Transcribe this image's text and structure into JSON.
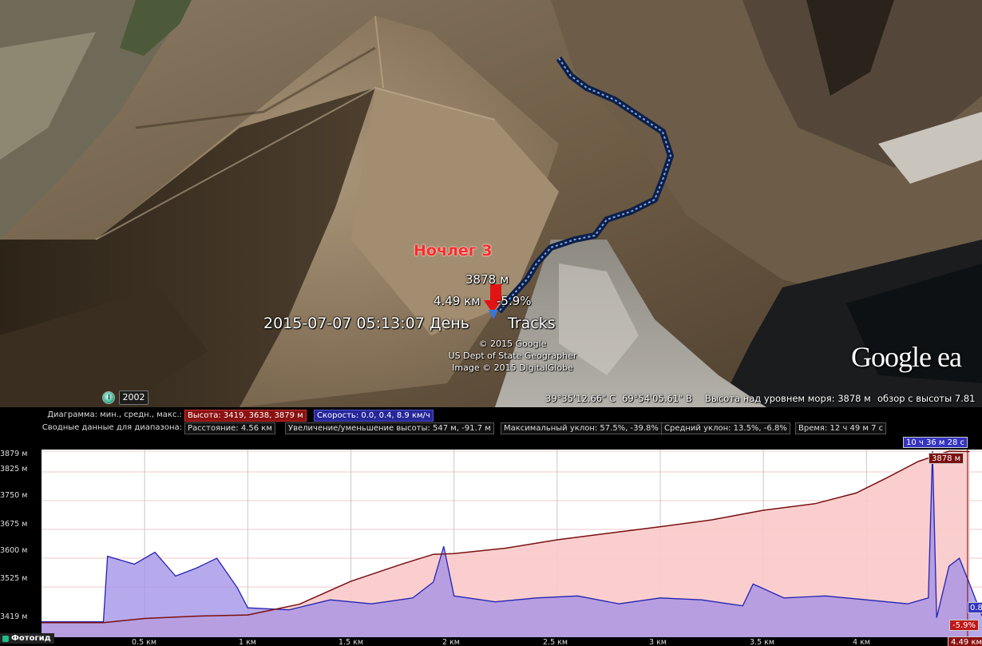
{
  "placemark": {
    "name": "Ночлег 3",
    "altitude": "3878 м",
    "distance": "4.49 км",
    "slope": "-5.9%",
    "datetime_label": "2015-07-07 05:13:07 День",
    "track_label": "Tracks"
  },
  "credits": [
    "© 2015 Google",
    "US Dept of State Geographer",
    "Image © 2015 DigitalGlobe"
  ],
  "logo": "Google ea",
  "status": {
    "year": "2002",
    "lat": "39°35'12.66\" С",
    "lon": "69°54'05.61\" В",
    "elevation": "Высота над уровнем моря:  3878 м",
    "eye": "обзор с высоты   7.81"
  },
  "profile": {
    "graph_label": "Диаграмма: мин., средн., макс.:",
    "alt_stats": "Высота: 3419, 3638, 3879 м",
    "speed_stats": "Скорость: 0.0, 0.4, 8.9 км/ч",
    "summary_label": "Сводные данные для диапазона:",
    "distance": "Расстояние: 4.56 км",
    "gain_loss": "Увеличение/уменьшение высоты: 547 м, -91.7 м",
    "max_slope": "Максимальный уклон: 57.5%, -39.8%",
    "avg_slope": "Средний уклон: 13.5%, -6.8%",
    "time": "Время: 12 ч 49 м 7 с",
    "cursor_time": "10 ч 36 м 28 с",
    "cursor_alt": "3878 м",
    "cursor_slope": "-5.9%",
    "cursor_dist": "4.49 км",
    "right_value": "0.8",
    "y_ticks": [
      "3879 м",
      "3825 м",
      "3750 м",
      "3675 м",
      "3600 м",
      "3525 м",
      "3419 м"
    ],
    "x_ticks": [
      "0.5 км",
      "1 км",
      "1.5 км",
      "2 км",
      "2.5 км",
      "3 км",
      "3.5 км",
      "4 км"
    ],
    "footer": "Фотогид"
  },
  "chart_data": {
    "type": "area",
    "xlabel": "",
    "ylabel": "",
    "xlim": [
      0,
      4.56
    ],
    "ylim": [
      3419,
      3879
    ],
    "series": [
      {
        "name": "Высота",
        "x": [
          0,
          0.3,
          0.5,
          0.75,
          1.0,
          1.25,
          1.5,
          1.75,
          1.9,
          2.0,
          2.25,
          2.5,
          2.75,
          3.0,
          3.25,
          3.5,
          3.75,
          3.95,
          4.1,
          4.25,
          4.35,
          4.4,
          4.5
        ],
        "values": [
          3432,
          3432,
          3443,
          3449,
          3452,
          3480,
          3540,
          3585,
          3610,
          3612,
          3626,
          3648,
          3665,
          3682,
          3700,
          3725,
          3742,
          3770,
          3810,
          3852,
          3870,
          3879,
          3878
        ]
      },
      {
        "name": "Скорость",
        "x": [
          0,
          0.3,
          0.32,
          0.45,
          0.55,
          0.65,
          0.75,
          0.85,
          0.95,
          1.0,
          1.2,
          1.4,
          1.6,
          1.8,
          1.9,
          1.95,
          2.0,
          2.2,
          2.4,
          2.6,
          2.8,
          3.0,
          3.2,
          3.4,
          3.45,
          3.6,
          3.8,
          4.0,
          4.2,
          4.3,
          4.32,
          4.34,
          4.4,
          4.45,
          4.5,
          4.56
        ],
        "values": [
          0.3,
          0.3,
          3.6,
          3.2,
          3.8,
          2.6,
          3.0,
          3.5,
          2.0,
          1.0,
          0.9,
          1.4,
          1.2,
          1.5,
          2.3,
          4.1,
          1.6,
          1.3,
          1.5,
          1.6,
          1.2,
          1.5,
          1.4,
          1.1,
          2.2,
          1.5,
          1.6,
          1.4,
          1.2,
          1.5,
          8.9,
          0.5,
          3.1,
          3.5,
          2.2,
          0.6
        ]
      }
    ]
  }
}
